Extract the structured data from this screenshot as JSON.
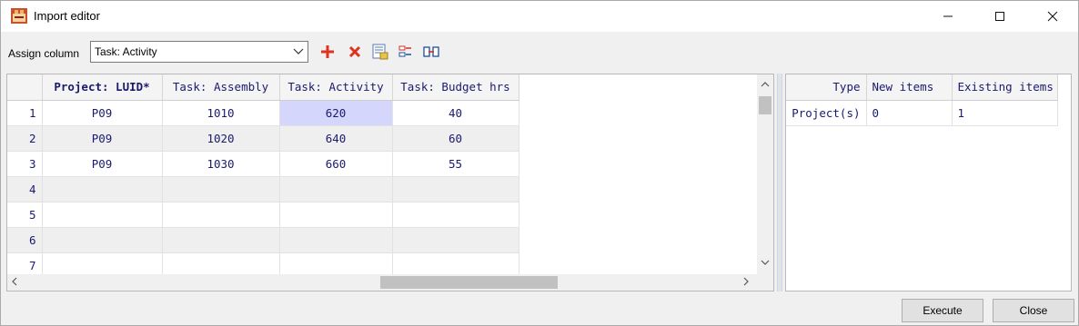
{
  "window": {
    "title": "Import editor",
    "icons": {
      "app": "import-app-icon",
      "minimize": "minimize-icon",
      "maximize": "maximize-icon",
      "close": "close-icon"
    }
  },
  "toolbar": {
    "assign_label": "Assign column",
    "assign_value": "Task: Activity",
    "icons": [
      "add-icon",
      "delete-icon",
      "column-settings-icon",
      "split-columns-icon",
      "merge-columns-icon"
    ]
  },
  "left_grid": {
    "columns": [
      "Project: LUID*",
      "Task: Assembly",
      "Task: Activity",
      "Task: Budget hrs"
    ],
    "rows": [
      {
        "num": "1",
        "cells": [
          "P09",
          "1010",
          "620",
          "40"
        ]
      },
      {
        "num": "2",
        "cells": [
          "P09",
          "1020",
          "640",
          "60"
        ]
      },
      {
        "num": "3",
        "cells": [
          "P09",
          "1030",
          "660",
          "55"
        ]
      },
      {
        "num": "4",
        "cells": [
          "",
          "",
          "",
          ""
        ]
      },
      {
        "num": "5",
        "cells": [
          "",
          "",
          "",
          ""
        ]
      },
      {
        "num": "6",
        "cells": [
          "",
          "",
          "",
          ""
        ]
      },
      {
        "num": "7",
        "cells": [
          "",
          "",
          "",
          ""
        ]
      }
    ]
  },
  "right_grid": {
    "columns": [
      "Type",
      "New items",
      "Existing items"
    ],
    "rows": [
      {
        "cells": [
          "Project(s)",
          "0",
          "1"
        ]
      }
    ]
  },
  "buttons": {
    "execute": "Execute",
    "close": "Close"
  },
  "colors": {
    "selected_cell": "#d4d7fb",
    "header_text": "#1a1a6e",
    "add_icon": "#e0301e",
    "delete_icon": "#e0301e"
  }
}
